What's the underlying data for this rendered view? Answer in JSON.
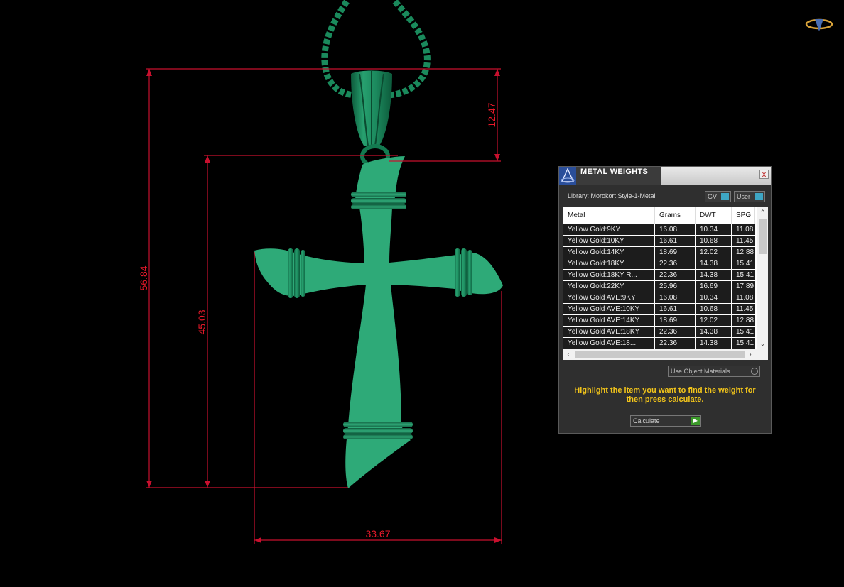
{
  "dimensions": {
    "total_height": "56.84",
    "cross_height": "45.03",
    "bail_height": "12.47",
    "width": "33.67"
  },
  "logo": {
    "icon": "gemvision-logo-icon"
  },
  "panel": {
    "title": "METAL WEIGHTS",
    "close_label": "x",
    "library_label": "Library: Morokort Style-1-Metal",
    "toggle_gv": "GV",
    "toggle_user": "User",
    "columns": [
      "Metal",
      "Grams",
      "DWT",
      "SPG"
    ],
    "rows": [
      {
        "metal": "Yellow Gold:9KY",
        "grams": "16.08",
        "dwt": "10.34",
        "spg": "11.08"
      },
      {
        "metal": "Yellow Gold:10KY",
        "grams": "16.61",
        "dwt": "10.68",
        "spg": "11.45"
      },
      {
        "metal": "Yellow Gold:14KY",
        "grams": "18.69",
        "dwt": "12.02",
        "spg": "12.88"
      },
      {
        "metal": "Yellow Gold:18KY",
        "grams": "22.36",
        "dwt": "14.38",
        "spg": "15.41"
      },
      {
        "metal": "Yellow Gold:18KY R...",
        "grams": "22.36",
        "dwt": "14.38",
        "spg": "15.41"
      },
      {
        "metal": "Yellow Gold:22KY",
        "grams": "25.96",
        "dwt": "16.69",
        "spg": "17.89"
      },
      {
        "metal": "Yellow Gold AVE:9KY",
        "grams": "16.08",
        "dwt": "10.34",
        "spg": "11.08"
      },
      {
        "metal": "Yellow Gold AVE:10KY",
        "grams": "16.61",
        "dwt": "10.68",
        "spg": "11.45"
      },
      {
        "metal": "Yellow Gold AVE:14KY",
        "grams": "18.69",
        "dwt": "12.02",
        "spg": "12.88"
      },
      {
        "metal": "Yellow Gold AVE:18KY",
        "grams": "22.36",
        "dwt": "14.38",
        "spg": "15.41"
      },
      {
        "metal": "Yellow Gold AVE:18...",
        "grams": "22.36",
        "dwt": "14.38",
        "spg": "15.41"
      }
    ],
    "use_object_materials": "Use Object Materials",
    "instructions": "Highlight the item you want to find the weight for then press calculate.",
    "calculate_label": "Calculate"
  },
  "colors": {
    "model": "#2eaa78",
    "dimension": "#c8102e",
    "instructions": "#f3c51a"
  }
}
